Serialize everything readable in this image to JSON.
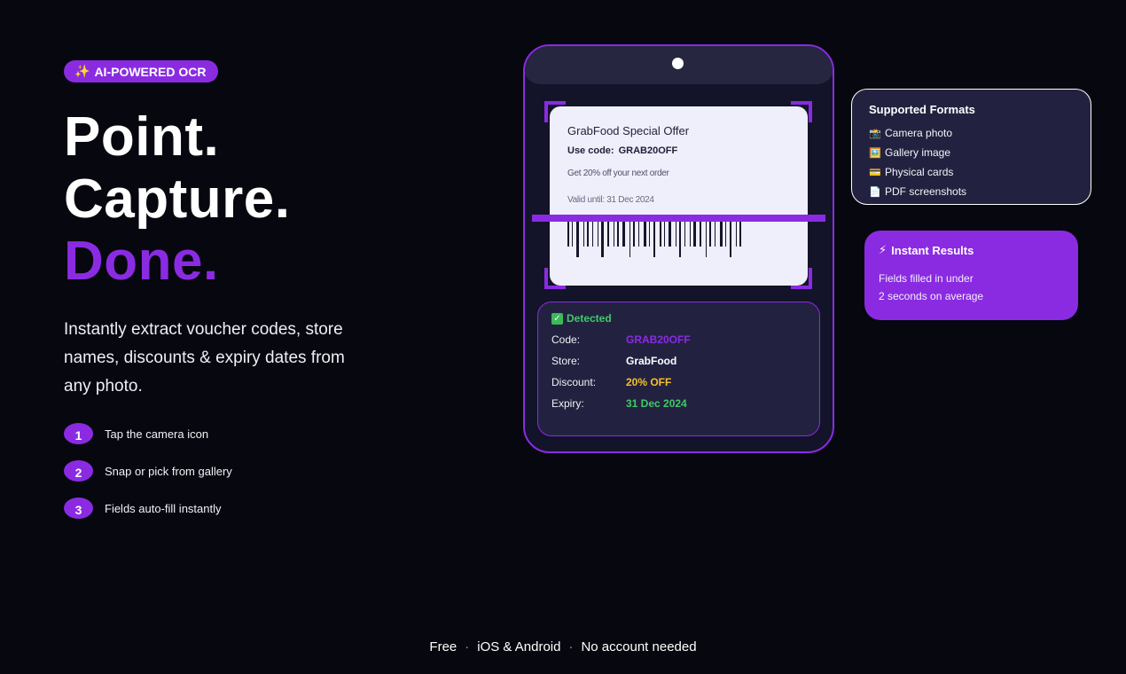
{
  "badge": {
    "icon": "✨",
    "label": "AI-POWERED OCR"
  },
  "headline": {
    "line1": "Point.",
    "line2": "Capture.",
    "line3": "Done."
  },
  "description": "Instantly extract voucher codes, store names, discounts & expiry dates from any photo.",
  "steps": [
    {
      "num": "1",
      "label": "Tap the camera icon"
    },
    {
      "num": "2",
      "label": "Snap or pick from gallery"
    },
    {
      "num": "3",
      "label": "Fields auto-fill instantly"
    }
  ],
  "footer": {
    "item1": "Free",
    "item2": "iOS & Android",
    "item3": "No account needed",
    "separator": "·"
  },
  "voucher": {
    "title": "GrabFood Special Offer",
    "code_label": "Use code:",
    "code_value": "GRAB20OFF",
    "offer": "Get 20% off your next order",
    "valid": "Valid until: 31 Dec 2024"
  },
  "detected": {
    "heading": "Detected",
    "rows": [
      {
        "key": "Code:",
        "value": "GRAB20OFF",
        "color": "#8a2be2"
      },
      {
        "key": "Store:",
        "value": "GrabFood",
        "color": "#ffffff"
      },
      {
        "key": "Discount:",
        "value": "20% OFF",
        "color": "#f5c02a"
      },
      {
        "key": "Expiry:",
        "value": "31 Dec 2024",
        "color": "#42c968"
      }
    ]
  },
  "formats": {
    "title": "Supported Formats",
    "items": [
      {
        "icon": "📸",
        "label": "Camera photo"
      },
      {
        "icon": "🖼️",
        "label": "Gallery image"
      },
      {
        "icon": "💳",
        "label": "Physical cards"
      },
      {
        "icon": "📄",
        "label": "PDF screenshots"
      }
    ]
  },
  "instant": {
    "icon": "⚡",
    "title": "Instant Results",
    "line1": "Fields filled in under",
    "line2": "2 seconds on average"
  },
  "colors": {
    "accent": "#8a2be2",
    "background": "#07070f",
    "success": "#42c968",
    "warning": "#f5c02a"
  }
}
